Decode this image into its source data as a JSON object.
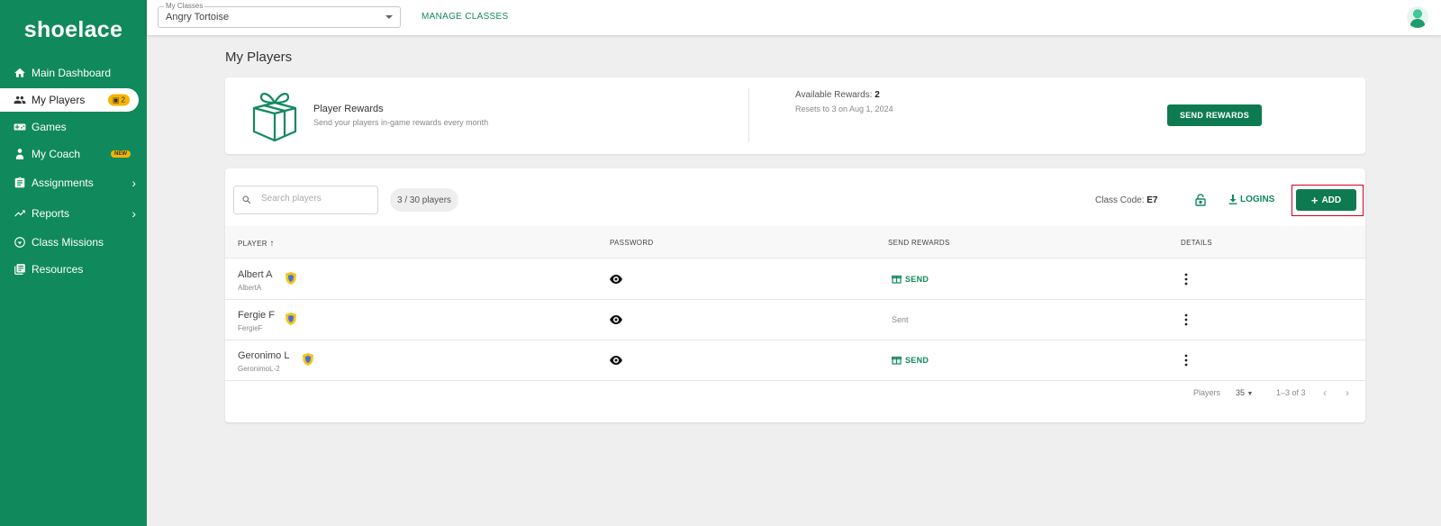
{
  "logo": "shoelace",
  "sidebar": {
    "items": [
      {
        "label": "Main Dashboard",
        "icon": "home-icon"
      },
      {
        "label": "My Players",
        "icon": "people-icon",
        "badge": "2"
      },
      {
        "label": "Games",
        "icon": "gamepad-icon"
      },
      {
        "label": "My Coach",
        "icon": "coach-icon",
        "badge": "NEW"
      },
      {
        "label": "Assignments",
        "icon": "clipboard-icon"
      },
      {
        "label": "Reports",
        "icon": "trend-icon"
      },
      {
        "label": "Class Missions",
        "icon": "mission-icon"
      },
      {
        "label": "Resources",
        "icon": "library-icon"
      }
    ]
  },
  "topbar": {
    "class_select_legend": "My Classes",
    "class_select_value": "Angry Tortoise",
    "manage_classes": "MANAGE CLASSES"
  },
  "page_title": "My Players",
  "rewards": {
    "title": "Player Rewards",
    "subtitle": "Send your players in-game rewards every month",
    "available_label": "Available Rewards:",
    "available_value": "2",
    "resets": "Resets to 3 on Aug 1, 2024",
    "send_button": "SEND REWARDS"
  },
  "players": {
    "search_placeholder": "Search players",
    "count": "3 / 30 players",
    "class_code_label": "Class Code:",
    "class_code_value": "E7",
    "logins": "LOGINS",
    "add": "ADD",
    "headers": {
      "player": "PLAYER",
      "password": "PASSWORD",
      "send_rewards": "SEND REWARDS",
      "details": "DETAILS"
    },
    "rows": [
      {
        "name": "Albert A",
        "username": "AlbertA",
        "reward": "SEND",
        "sent": false
      },
      {
        "name": "Fergie F",
        "username": "FergieF",
        "reward": "Sent",
        "sent": true
      },
      {
        "name": "Geronimo L",
        "username": "GeronimoL-2",
        "reward": "SEND",
        "sent": false
      }
    ],
    "footer": {
      "rows_label": "Players",
      "rows_value": "35",
      "range": "1–3 of 3"
    }
  },
  "colors": {
    "brand": "#108a5c",
    "accent": "#f5b301",
    "highlight": "#d0021b"
  }
}
